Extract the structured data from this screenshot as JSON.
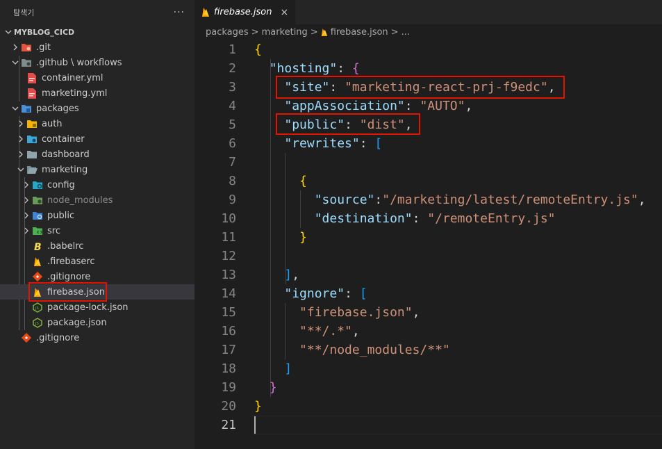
{
  "explorer": {
    "title": "탐색기",
    "more_label": "···",
    "root_label": "MYBLOG_CICD",
    "items": [
      {
        "label": ".git",
        "icon": "git-folder-icon"
      },
      {
        "label": ".github \\ workflows",
        "icon": "github-folder-icon"
      },
      {
        "label": "container.yml",
        "icon": "yaml-file-icon"
      },
      {
        "label": "marketing.yml",
        "icon": "yaml-file-icon"
      },
      {
        "label": "packages",
        "icon": "packages-folder-icon"
      },
      {
        "label": "auth",
        "icon": "folder-icon"
      },
      {
        "label": "container",
        "icon": "folder-icon"
      },
      {
        "label": "dashboard",
        "icon": "folder-icon"
      },
      {
        "label": "marketing",
        "icon": "folder-open-icon"
      },
      {
        "label": "config",
        "icon": "config-folder-icon"
      },
      {
        "label": "node_modules",
        "icon": "node-folder-icon"
      },
      {
        "label": "public",
        "icon": "public-folder-icon"
      },
      {
        "label": "src",
        "icon": "src-folder-icon"
      },
      {
        "label": ".babelrc",
        "icon": "babel-file-icon"
      },
      {
        "label": ".firebaserc",
        "icon": "firebase-file-icon"
      },
      {
        "label": ".gitignore",
        "icon": "git-file-icon"
      },
      {
        "label": "firebase.json",
        "icon": "firebase-file-icon"
      },
      {
        "label": "package-lock.json",
        "icon": "nodejs-file-icon"
      },
      {
        "label": "package.json",
        "icon": "nodejs-file-icon"
      },
      {
        "label": ".gitignore",
        "icon": "git-file-icon"
      }
    ]
  },
  "tab": {
    "label": "firebase.json",
    "close": "×"
  },
  "breadcrumb": {
    "parts": [
      "packages",
      "marketing",
      "firebase.json",
      "..."
    ],
    "sep": ">"
  },
  "code": {
    "line_numbers": [
      "1",
      "2",
      "3",
      "4",
      "5",
      "6",
      "7",
      "8",
      "9",
      "10",
      "11",
      "12",
      "13",
      "14",
      "15",
      "16",
      "17",
      "18",
      "19",
      "20",
      "21"
    ],
    "tokens": {
      "l1_open": "{",
      "l2_key": "\"hosting\"",
      "l2_colon": ": ",
      "l2_open": "{",
      "l3_key": "\"site\"",
      "l3_colon": ": ",
      "l3_val": "\"marketing-react-prj-f9edc\"",
      "l3_comma": ",",
      "l4_key": "\"appAssociation\"",
      "l4_colon": ": ",
      "l4_val": "\"AUTO\"",
      "l4_comma": ",",
      "l5_key": "\"public\"",
      "l5_colon": ": ",
      "l5_val": "\"dist\"",
      "l5_comma": ",",
      "l6_key": "\"rewrites\"",
      "l6_colon": ": ",
      "l6_open": "[",
      "l8_open": "{",
      "l9_key": "\"source\"",
      "l9_colon": ":",
      "l9_val": "\"/marketing/latest/remoteEntry.js\"",
      "l9_comma": ",",
      "l10_key": "\"destination\"",
      "l10_colon": ": ",
      "l10_val": "\"/remoteEntry.js\"",
      "l11_close": "}",
      "l13_close": "]",
      "l13_comma": ",",
      "l14_key": "\"ignore\"",
      "l14_colon": ": ",
      "l14_open": "[",
      "l15_val": "\"firebase.json\"",
      "l15_comma": ",",
      "l16_val": "\"**/.*\"",
      "l16_comma": ",",
      "l17_val": "\"**/node_modules/**\"",
      "l18_close": "]",
      "l19_close": "}",
      "l20_close": "}"
    }
  },
  "colors": {
    "highlight_box": "#e51400",
    "key": "#9cdcfe",
    "string": "#ce9178",
    "bracket_level1": "#ffd700",
    "bracket_level2": "#da70d6",
    "bracket_level3": "#179fff"
  }
}
